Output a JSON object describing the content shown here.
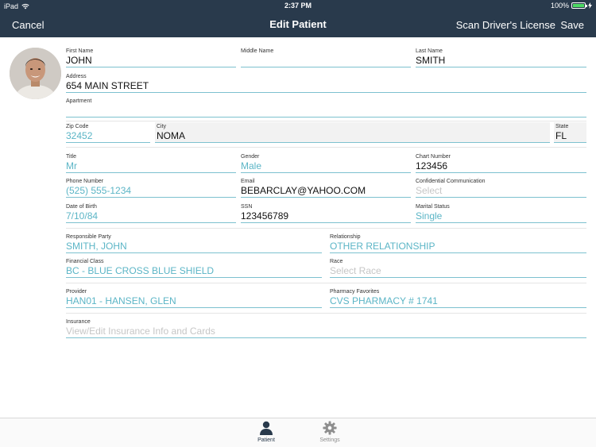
{
  "status_bar": {
    "device": "iPad",
    "time": "2:37 PM",
    "battery": "100%",
    "battery_level": 1.0
  },
  "nav": {
    "cancel_label": "Cancel",
    "title": "Edit Patient",
    "scan_label": "Scan Driver's License",
    "save_label": "Save"
  },
  "form": {
    "first_name": {
      "label": "First Name",
      "value": "JOHN"
    },
    "middle_name": {
      "label": "Middle Name",
      "value": ""
    },
    "last_name": {
      "label": "Last Name",
      "value": "SMITH"
    },
    "address": {
      "label": "Address",
      "value": "654 MAIN STREET"
    },
    "apartment": {
      "label": "Apartment",
      "value": ""
    },
    "zip": {
      "label": "Zip Code",
      "value": "32452"
    },
    "city": {
      "label": "City",
      "value": "NOMA"
    },
    "state": {
      "label": "State",
      "value": "FL"
    },
    "title": {
      "label": "Title",
      "value": "Mr"
    },
    "gender": {
      "label": "Gender",
      "value": "Male"
    },
    "chart_number": {
      "label": "Chart Number",
      "value": "123456"
    },
    "phone": {
      "label": "Phone Number",
      "value": "(525) 555-1234"
    },
    "email": {
      "label": "Email",
      "value": "BEBARCLAY@YAHOO.COM"
    },
    "confidential": {
      "label": "Confidential Communication",
      "placeholder": "Select"
    },
    "dob": {
      "label": "Date of Birth",
      "value": "7/10/84"
    },
    "ssn": {
      "label": "SSN",
      "value": "123456789"
    },
    "marital": {
      "label": "Marital Status",
      "value": "Single"
    },
    "responsible": {
      "label": "Responsible Party",
      "value": "SMITH, JOHN"
    },
    "relationship": {
      "label": "Relationship",
      "value": "OTHER RELATIONSHIP"
    },
    "financial": {
      "label": "Financial Class",
      "value": "BC - BLUE CROSS BLUE SHIELD"
    },
    "race": {
      "label": "Race",
      "placeholder": "Select Race"
    },
    "provider": {
      "label": "Provider",
      "value": "HAN01 - HANSEN, GLEN"
    },
    "pharmacy": {
      "label": "Pharmacy Favorites",
      "value": "CVS PHARMACY # 1741"
    },
    "insurance": {
      "label": "Insurance",
      "placeholder": "View/Edit Insurance Info and Cards"
    }
  },
  "tabs": {
    "patient": "Patient",
    "settings": "Settings"
  },
  "colors": {
    "header_bg": "#293a4c",
    "accent": "#5bb5c6",
    "underline": "#7dc1cf"
  }
}
